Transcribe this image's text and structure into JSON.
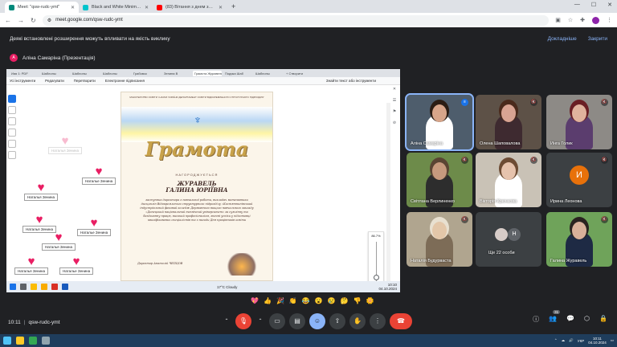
{
  "browser": {
    "tabs": [
      {
        "label": "Meet: \"qsw-rudc-ymt\"",
        "color": "#00897b",
        "active": true
      },
      {
        "label": "Black and White Minimalist Ar...",
        "color": "#00c4cc",
        "active": false
      },
      {
        "label": "(83) Вітання з днем захисник...",
        "color": "#ff0000",
        "active": false
      }
    ],
    "new_tab": "+",
    "url": "meet.google.com/qsw-rudc-ymt"
  },
  "info_bar": {
    "message": "Деякі встановлені розширення можуть впливати на якість виклику",
    "details_link": "Докладніше",
    "close_link": "Закрити"
  },
  "presenter": {
    "initial": "А",
    "label": "Аліна Самаріна (Презентація)"
  },
  "shared_screen": {
    "tabs": [
      "Ияя 1: PDF",
      "Шаблоны",
      "Шаблоны",
      "Шаблоны",
      "Грабовск",
      "Зенина В",
      "Грамота Журавель Г...",
      "Подяка Шаб",
      "Шаблоны",
      "+ Створити"
    ],
    "menu": [
      "Усі інструменти",
      "Редагувати",
      "Перетворити",
      "Електронне підписання"
    ],
    "search": "Знайти текст або інструменти",
    "stickers": [
      {
        "name": "Наталья Зенина",
        "faded": true
      },
      {
        "name": "Наталье Зенина",
        "faded": false
      },
      {
        "name": "Наталья Зенина",
        "faded": false
      },
      {
        "name": "Наталья Зенина",
        "faded": false
      },
      {
        "name": "Наталье Зенина",
        "faded": false
      },
      {
        "name": "Наталья Зенина",
        "faded": false
      },
      {
        "name": "Наталья Зенина",
        "faded": false
      },
      {
        "name": "Наталье Зенина",
        "faded": false
      }
    ],
    "certificate": {
      "header": "МІНІСТЕРСТВО ОСВІТИ І НАУКИ УКРАЇНИ ДЕПАРТАМЕНТ ОСВІТИ ВІДОКРЕМЛЕНОГО СТРУКТУРНОГО ПІДРОЗДІЛУ",
      "title": "Грамота",
      "awarded": "НАГОРОДЖУЄТЬСЯ",
      "surname": "ЖУРАВЕЛЬ",
      "name": "ГАЛИНА ЮРІЇВНА",
      "body": "заступник директора з навчальної роботи, викладач математики дисциплін Відокремленого структурного підрозділу «Костянтинівський індустріальний фаховий коледж Державного вищого навчального закладу «Донецький національний технічний університет» за сумлінну та бездоганну працю, високий професіоналізм, значні успіхи у підготовці кваліфікованих спеціалістів та з нагоди Дня працівників освіти",
      "signature": "Директор Анатолій ЧЕПЦОВ"
    },
    "zoom": "86.7%",
    "zoom_level": 0.867,
    "taskbar": {
      "weather": "17°C Cloudy",
      "time": "10:10",
      "date": "04.10.2024"
    }
  },
  "participants": [
    {
      "name": "Аліна Самаріна",
      "mic": "speaking",
      "bg": "#4e5d6c",
      "body": "#ffffff",
      "skin": "#d7a58a",
      "hair": "#2b1d14"
    },
    {
      "name": "Олена Шаповалова",
      "mic": "muted",
      "bg": "#5d5147",
      "body": "#3e2a30",
      "skin": "#d9a493",
      "hair": "#4a2a1c"
    },
    {
      "name": "Инга Голик",
      "mic": "muted",
      "bg": "#8d8a86",
      "body": "#5b3d6e",
      "skin": "#e0b29d",
      "hair": "#6a1e24"
    },
    {
      "name": "Світлана Верлиненко",
      "mic": "muted",
      "bg": "#6d8b4a",
      "body": "#2d2d2d",
      "skin": "#c79a7e",
      "hair": "#5a4433"
    },
    {
      "name": "Вікторія Крючкова",
      "mic": "muted",
      "bg": "#c9c2b6",
      "body": "#ffffff",
      "skin": "#e6c3ad",
      "hair": "#6d4c34"
    },
    {
      "name": "Ирина Леонова",
      "mic": "muted",
      "initial": "И"
    },
    {
      "name": "Наталія Будурваста",
      "mic": "muted",
      "bg": "#b0a58f",
      "body": "#7d6c57",
      "skin": "#e3c7a9",
      "hair": "#e8e0d0"
    },
    {
      "name": "Ще 22 особи",
      "more": true,
      "initial": "Н"
    },
    {
      "name": "Галина Журавель",
      "mic": "muted",
      "bg": "#6fa35a",
      "body": "#1e2a44",
      "skin": "#d9b09a",
      "hair": "#2a2220"
    }
  ],
  "reactions": [
    "💖",
    "👍",
    "🎉",
    "👏",
    "😂",
    "😮",
    "😢",
    "🤔",
    "👎",
    "🌼"
  ],
  "meeting": {
    "time": "10:11",
    "separator": "|",
    "code": "qsw-rudc-ymt",
    "people_count": "31"
  },
  "windows_taskbar": {
    "lang": "УКР",
    "time": "10:11",
    "date": "04.10.2024"
  }
}
